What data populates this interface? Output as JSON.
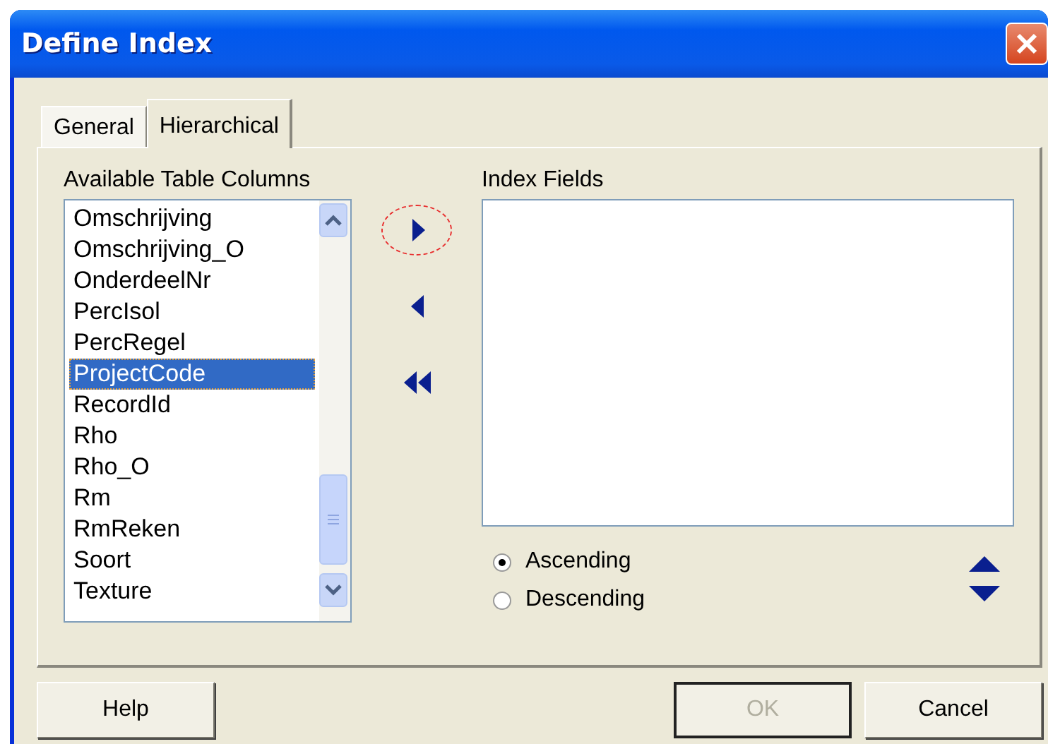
{
  "window": {
    "title": "Define Index"
  },
  "tabs": [
    {
      "label": "General",
      "selected": false
    },
    {
      "label": "Hierarchical",
      "selected": true
    }
  ],
  "available_columns": {
    "label": "Available Table Columns",
    "items": [
      {
        "text": "Omschrijving",
        "selected": false
      },
      {
        "text": "Omschrijving_O",
        "selected": false
      },
      {
        "text": "OnderdeelNr",
        "selected": false
      },
      {
        "text": "PercIsol",
        "selected": false
      },
      {
        "text": "PercRegel",
        "selected": false
      },
      {
        "text": "ProjectCode",
        "selected": true
      },
      {
        "text": "RecordId",
        "selected": false
      },
      {
        "text": "Rho",
        "selected": false
      },
      {
        "text": "Rho_O",
        "selected": false
      },
      {
        "text": "Rm",
        "selected": false
      },
      {
        "text": "RmReken",
        "selected": false
      },
      {
        "text": "Soort",
        "selected": false
      },
      {
        "text": "Texture",
        "selected": false
      }
    ]
  },
  "move_buttons": [
    {
      "kind": "add",
      "highlighted": true
    },
    {
      "kind": "remove",
      "highlighted": false
    },
    {
      "kind": "remove_all",
      "highlighted": false
    }
  ],
  "index_fields": {
    "label": "Index Fields"
  },
  "sort_order": [
    {
      "label": "Ascending",
      "selected": true
    },
    {
      "label": "Descending",
      "selected": false
    }
  ],
  "buttons": [
    {
      "label": "Help",
      "disabled": false
    },
    {
      "label": "OK",
      "disabled": true
    },
    {
      "label": "Cancel",
      "disabled": false
    }
  ]
}
